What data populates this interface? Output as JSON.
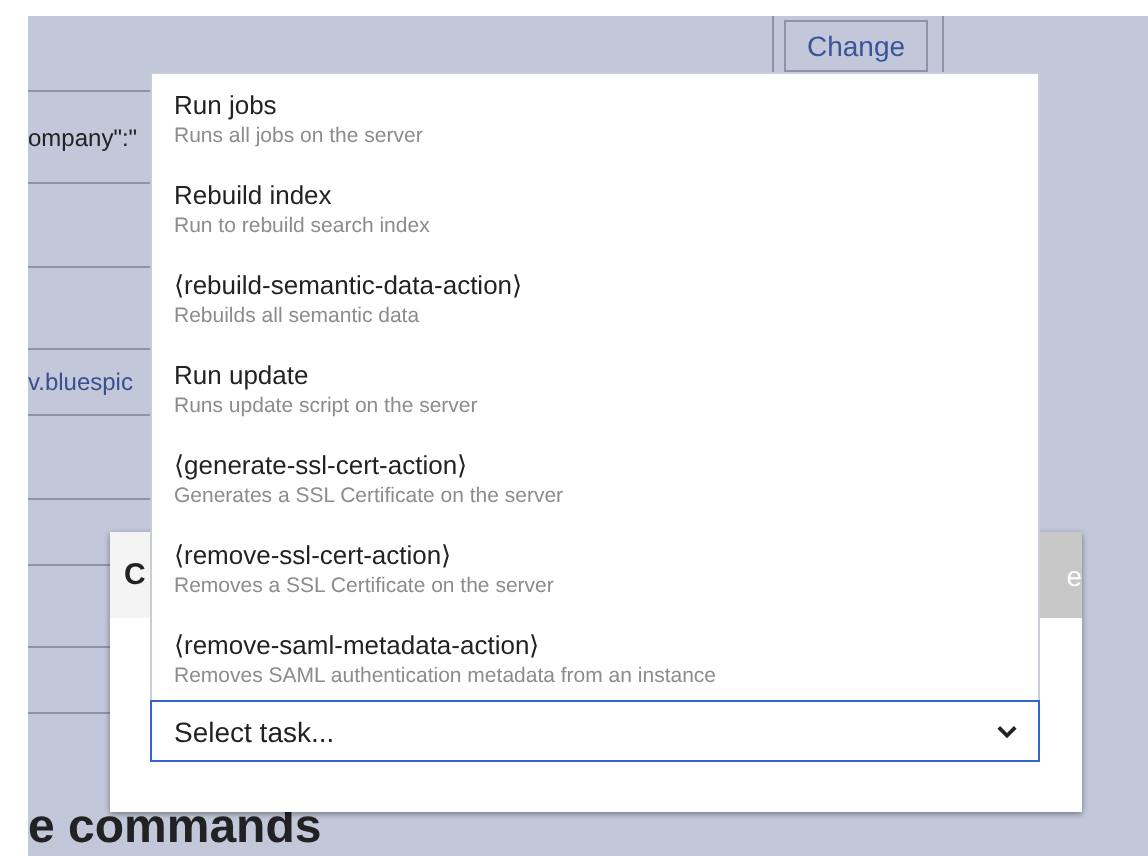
{
  "background_page": {
    "change_button": "Change",
    "rows": [
      {
        "text": ""
      },
      {
        "text": "ompany\":\"",
        "kind": "plain"
      },
      {
        "text": ""
      },
      {
        "text": ""
      },
      {
        "text": "v.bluespic",
        "kind": "link"
      },
      {
        "text": ""
      },
      {
        "text": ""
      },
      {
        "text": ""
      },
      {
        "text": ""
      }
    ],
    "heading": "e commands"
  },
  "dialog": {
    "title": "C",
    "action": "e"
  },
  "task_select": {
    "value": "Select task...",
    "expanded": true,
    "options": [
      {
        "title": "Run jobs",
        "description": "Runs all jobs on the server"
      },
      {
        "title": "Rebuild index",
        "description": "Run to rebuild search index"
      },
      {
        "title": "⟨rebuild-semantic-data-action⟩",
        "description": "Rebuilds all semantic data"
      },
      {
        "title": "Run update",
        "description": "Runs update script on the server"
      },
      {
        "title": "⟨generate-ssl-cert-action⟩",
        "description": "Generates a SSL Certificate on the server"
      },
      {
        "title": "⟨remove-ssl-cert-action⟩",
        "description": "Removes a SSL Certificate on the server"
      },
      {
        "title": "⟨remove-saml-metadata-action⟩",
        "description": "Removes SAML authentication metadata from an instance"
      }
    ]
  }
}
